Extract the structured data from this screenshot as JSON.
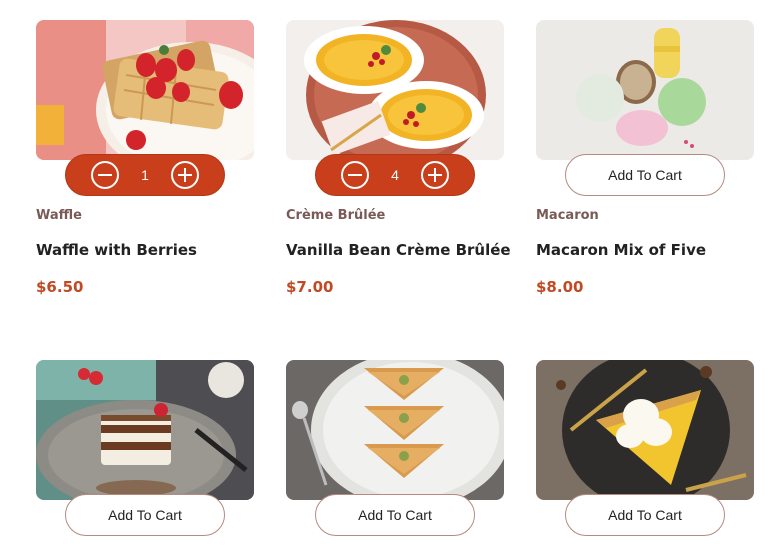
{
  "accent_color": "#c93f1c",
  "products": [
    {
      "image": "waffle-with-berries-photo",
      "cart": {
        "type": "stepper",
        "quantity": "1",
        "decrement_icon": "minus-circle-icon",
        "increment_icon": "plus-circle-icon"
      },
      "category": "Waffle",
      "title": "Waffle with Berries",
      "price": "$6.50"
    },
    {
      "image": "creme-brulee-photo",
      "cart": {
        "type": "stepper",
        "quantity": "4",
        "decrement_icon": "minus-circle-icon",
        "increment_icon": "plus-circle-icon"
      },
      "category": "Crème Brûlée",
      "title": "Vanilla Bean Crème Brûlée",
      "price": "$7.00"
    },
    {
      "image": "macarons-photo",
      "cart": {
        "type": "button",
        "label": "Add To Cart"
      },
      "category": "Macaron",
      "title": "Macaron Mix of Five",
      "price": "$8.00"
    },
    {
      "image": "tiramisu-photo",
      "cart": {
        "type": "button",
        "label": "Add To Cart"
      }
    },
    {
      "image": "baklava-photo",
      "cart": {
        "type": "button",
        "label": "Add To Cart"
      }
    },
    {
      "image": "pie-with-cream-photo",
      "cart": {
        "type": "button",
        "label": "Add To Cart"
      }
    }
  ]
}
